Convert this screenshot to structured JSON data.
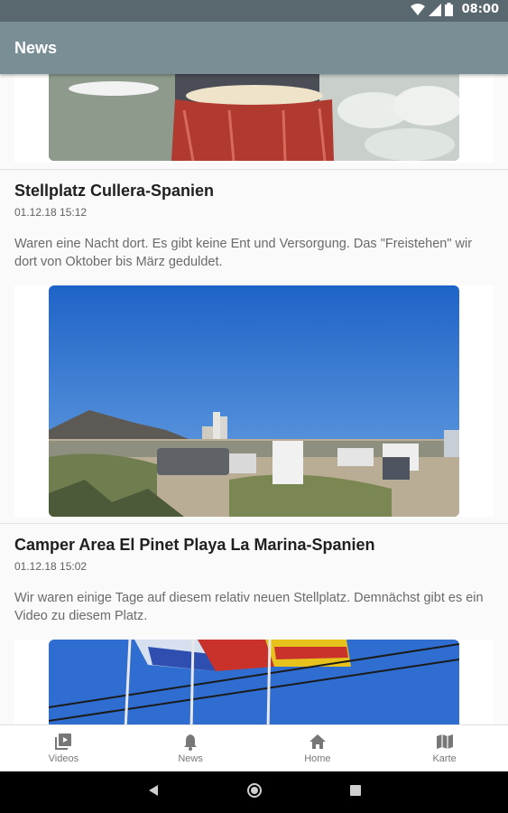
{
  "status_bar": {
    "time": "08:00"
  },
  "app_bar": {
    "title": "News"
  },
  "articles": [
    {
      "title": "Stellplatz Cullera-Spanien",
      "date": "01.12.18 15:12",
      "body": "Waren eine Nacht dort. Es gibt keine Ent und Versorgung. Das \"Freistehen\" wir dort von Oktober bis März geduldet."
    },
    {
      "title": "Camper Area El Pinet Playa La Marina-Spanien",
      "date": "01.12.18 15:02",
      "body": "Wir waren einige Tage auf diesem relativ neuen Stellplatz. Demnächst gibt es ein Video zu diesem Platz."
    }
  ],
  "bottom_nav": [
    {
      "label": "Videos",
      "icon": "video-library-icon"
    },
    {
      "label": "News",
      "icon": "bell-icon"
    },
    {
      "label": "Home",
      "icon": "home-icon"
    },
    {
      "label": "Karte",
      "icon": "map-icon"
    }
  ],
  "system_nav": {
    "icons": [
      "back-icon",
      "home-circle-icon",
      "recents-icon"
    ]
  },
  "colors": {
    "app_bar": "#7a8e95",
    "status_bar": "#59686f",
    "nav_inactive": "#777777"
  }
}
